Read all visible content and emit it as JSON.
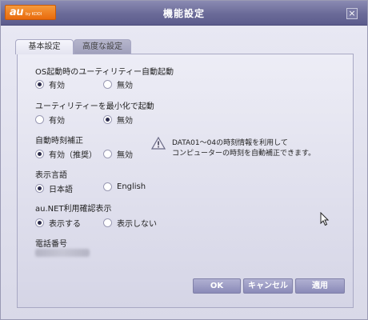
{
  "window": {
    "title": "機能設定",
    "logo_main": "au",
    "logo_sub": "by KDDI",
    "close_label": "×"
  },
  "tabs": [
    {
      "label": "基本設定",
      "active": true
    },
    {
      "label": "高度な設定",
      "active": false
    }
  ],
  "settings": {
    "autostart": {
      "label": "OS起動時のユーティリティー自動起動",
      "options": [
        {
          "label": "有効",
          "checked": true
        },
        {
          "label": "無効",
          "checked": false
        }
      ]
    },
    "minimized": {
      "label": "ユーティリティーを最小化で起動",
      "options": [
        {
          "label": "有効",
          "checked": false
        },
        {
          "label": "無効",
          "checked": true
        }
      ]
    },
    "time_correction": {
      "label": "自動時刻補正",
      "options": [
        {
          "label": "有効（推奨）",
          "checked": true
        },
        {
          "label": "無効",
          "checked": false
        }
      ],
      "note_line1": "DATA01～04の時刻情報を利用して",
      "note_line2": "コンピューターの時刻を自動補正できます。"
    },
    "language": {
      "label": "表示言語",
      "options": [
        {
          "label": "日本語",
          "checked": true
        },
        {
          "label": "English",
          "checked": false
        }
      ]
    },
    "aunet": {
      "label": "au.NET利用確認表示",
      "options": [
        {
          "label": "表示する",
          "checked": true
        },
        {
          "label": "表示しない",
          "checked": false
        }
      ]
    },
    "phone": {
      "label": "電話番号"
    }
  },
  "buttons": {
    "ok": "OK",
    "cancel": "キャンセル",
    "apply": "適用"
  },
  "colors": {
    "titlebar": "#6a6a98",
    "logo": "#e96a0c",
    "button": "#8a8ab8"
  }
}
